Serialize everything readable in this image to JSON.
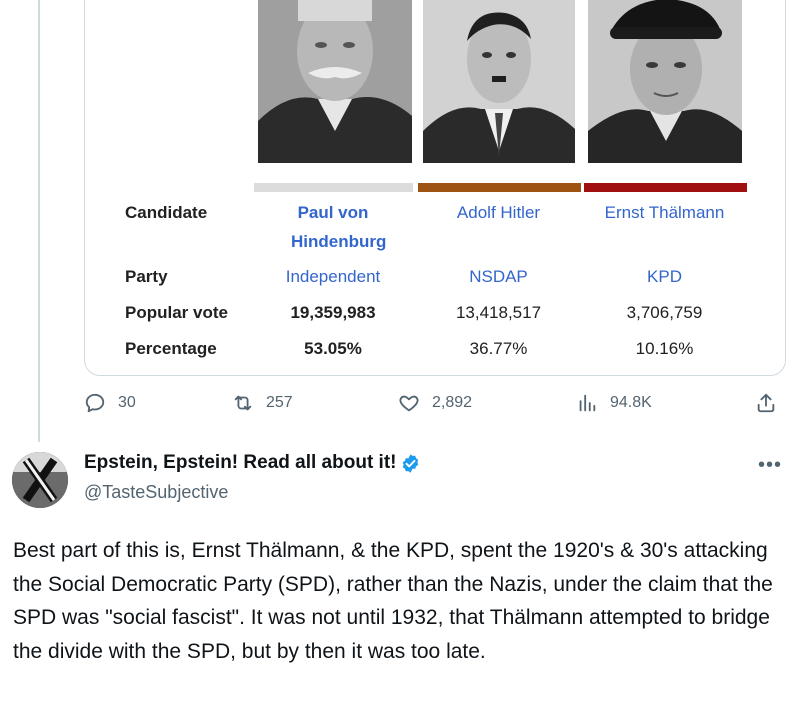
{
  "table": {
    "labels": {
      "candidate": "Candidate",
      "party": "Party",
      "popular_vote": "Popular vote",
      "percentage": "Percentage"
    },
    "candidates": [
      {
        "name": "Paul von Hindenburg",
        "party": "Independent",
        "votes": "19,359,983",
        "percentage": "53.05%",
        "bar_color": "#dcdcdc"
      },
      {
        "name": "Adolf Hitler",
        "party": "NSDAP",
        "votes": "13,418,517",
        "percentage": "36.77%",
        "bar_color": "#9e5313"
      },
      {
        "name": "Ernst Thälmann",
        "party": "KPD",
        "votes": "3,706,759",
        "percentage": "10.16%",
        "bar_color": "#a01010"
      }
    ]
  },
  "actions": {
    "replies": "30",
    "reposts": "257",
    "likes": "2,892",
    "views": "94.8K"
  },
  "reply": {
    "display_name": "Epstein, Epstein! Read all about it!",
    "handle": "@TasteSubjective",
    "text": "Best part of this is, Ernst Thälmann, & the KPD, spent the 1920's & 30's attacking the Social Democratic Party (SPD), rather than the Nazis, under the claim that the SPD was \"social fascist\". It was not until 1932, that Thälmann attempted to bridge the divide with the SPD, but by then it was too late."
  },
  "icons": {
    "reply": "speech-bubble-icon",
    "repost": "repost-arrows-icon",
    "like": "heart-icon",
    "views": "bar-chart-icon",
    "share": "share-upload-icon",
    "verified": "verified-badge-icon",
    "more": "more-dots-icon"
  },
  "colors": {
    "link": "#3366cc",
    "muted": "#536471",
    "verified": "#1d9bf0"
  }
}
